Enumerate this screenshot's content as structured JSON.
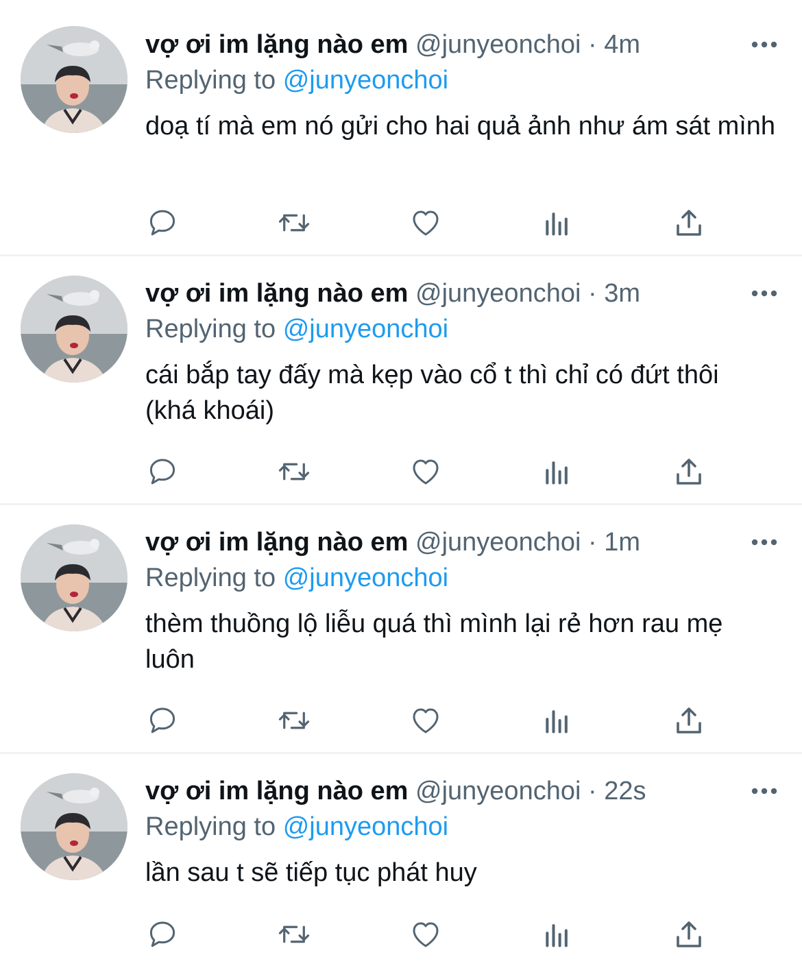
{
  "tweets": [
    {
      "display_name": "vợ ơi im lặng nào em",
      "handle": "@junyeonchoi",
      "separator": "·",
      "time": "4m",
      "replying_prefix": "Replying to",
      "replying_to": "@junyeonchoi",
      "text": "doạ tí mà em nó gửi cho hai quả ảnh như ám sát mình"
    },
    {
      "display_name": "vợ ơi im lặng nào em",
      "handle": "@junyeonchoi",
      "separator": "·",
      "time": "3m",
      "replying_prefix": "Replying to",
      "replying_to": "@junyeonchoi",
      "text": "cái bắp tay đấy mà kẹp vào cổ t thì chỉ có đứt thôi (khá khoái)"
    },
    {
      "display_name": "vợ ơi im lặng nào em",
      "handle": "@junyeonchoi",
      "separator": "·",
      "time": "1m",
      "replying_prefix": "Replying to",
      "replying_to": "@junyeonchoi",
      "text": "thèm thuồng lộ liễu quá thì mình lại rẻ hơn rau mẹ luôn"
    },
    {
      "display_name": "vợ ơi im lặng nào em",
      "handle": "@junyeonchoi",
      "separator": "·",
      "time": "22s",
      "replying_prefix": "Replying to",
      "replying_to": "@junyeonchoi",
      "text": "lần sau t sẽ tiếp tục phát huy"
    }
  ],
  "icons": {
    "more": "more-horizontal-icon",
    "reply": "reply-bubble-icon",
    "retweet": "retweet-icon",
    "like": "heart-icon",
    "analytics": "bar-chart-icon",
    "share": "share-upload-icon"
  },
  "colors": {
    "text": "#0f1419",
    "secondary": "#536471",
    "link": "#1d9bf0",
    "divider": "#eff3f4"
  }
}
